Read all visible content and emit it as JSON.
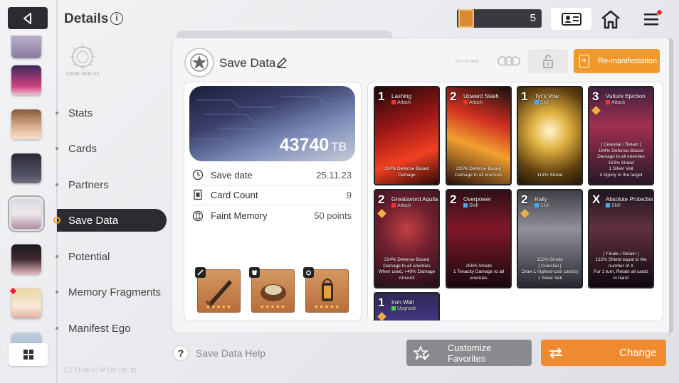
{
  "header": {
    "title": "Details",
    "info_icon": "i"
  },
  "emblem_caption": "ΣΘΞΘ-ЧΕΘ-ЗЗ",
  "nav": [
    {
      "label": "Stats",
      "active": false
    },
    {
      "label": "Cards",
      "active": false
    },
    {
      "label": "Partners",
      "active": false
    },
    {
      "label": "Save Data",
      "active": true
    },
    {
      "label": "Potential",
      "active": false
    },
    {
      "label": "Memory Fragments",
      "active": false
    },
    {
      "label": "Manifest Ego",
      "active": false
    }
  ],
  "topbar": {
    "currency_value": "5"
  },
  "panel": {
    "title": "Save Data",
    "tiny_label": "ΞΤΥ ΙΙΙ·ΗΕΒ:",
    "remanifest_label": "Re-manifestation",
    "banner": {
      "value": "43740",
      "unit": "TB"
    },
    "stats": [
      {
        "label": "Save date",
        "value": "25.11.23",
        "icon": "clock-icon"
      },
      {
        "label": "Card Count",
        "value": "9",
        "icon": "card-icon"
      },
      {
        "label": "Faint Memory",
        "value": "50 points",
        "icon": "memory-icon"
      }
    ],
    "equipment": [
      {
        "slot": "weapon",
        "stars": "★★★★★"
      },
      {
        "slot": "armor",
        "stars": "★★★★★"
      },
      {
        "slot": "accessory",
        "stars": "★★★★★"
      }
    ]
  },
  "cards": [
    {
      "cost": "1",
      "name": "Lashing",
      "type": "Attack",
      "desc": "114% Defense-Based Damage",
      "palette": "red"
    },
    {
      "cost": "2",
      "name": "Upward Slash",
      "type": "Attack",
      "desc": "205% Defense-Based Damage to all enemies",
      "palette": "red"
    },
    {
      "cost": "1",
      "name": "Tyr's Vow",
      "type": "Skill",
      "desc": "114% Shield",
      "palette": "gold"
    },
    {
      "cost": "3",
      "name": "Vulture Ejection",
      "type": "Attack",
      "desc": "[ Celestial / Retain ]\n184% Defense-Based Damage to all enemies\n153% Shield\n1 Silver Veil\n4 Agony to the target",
      "palette": "purple"
    },
    {
      "cost": "2",
      "name": "Greatsword Aquila",
      "type": "Attack",
      "desc": "224% Defense-Based Damage to all enemies\nWhen used, +40% Damage Amount",
      "palette": "crimson"
    },
    {
      "cost": "2",
      "name": "Overpower",
      "type": "Skill",
      "desc": "255% Shield\n1 Tenacity Damage to all enemies",
      "palette": "darkred"
    },
    {
      "cost": "2",
      "name": "Rally",
      "type": "Skill",
      "desc": "153% Shield\n[ Celestial ]\nDraw 1 highest-cost card(s)\n1 Silver Veil",
      "palette": "grey"
    },
    {
      "cost": "X",
      "name": "Absolute Protection",
      "type": "Skill",
      "desc": "[ Finale / Retain ]\n122% Shield equal to the number of X\nFor 1 turn, Retain all cards in hand",
      "palette": "darkgrey"
    },
    {
      "cost": "1",
      "name": "Iron Wall",
      "type": "Upgrade",
      "desc": "",
      "palette": "blue"
    }
  ],
  "bottom": {
    "help_label": "Save Data Help",
    "favorites_label": "Customize Favorites",
    "change_label": "Change",
    "deco_text": "ΣΞΞΗΘ-ΙΞΨΞΘ-ΙΘ.ЗІ"
  },
  "colors": {
    "accent_orange": "#f08a30",
    "dark": "#2c2c30",
    "panel": "#f5f5f7"
  }
}
